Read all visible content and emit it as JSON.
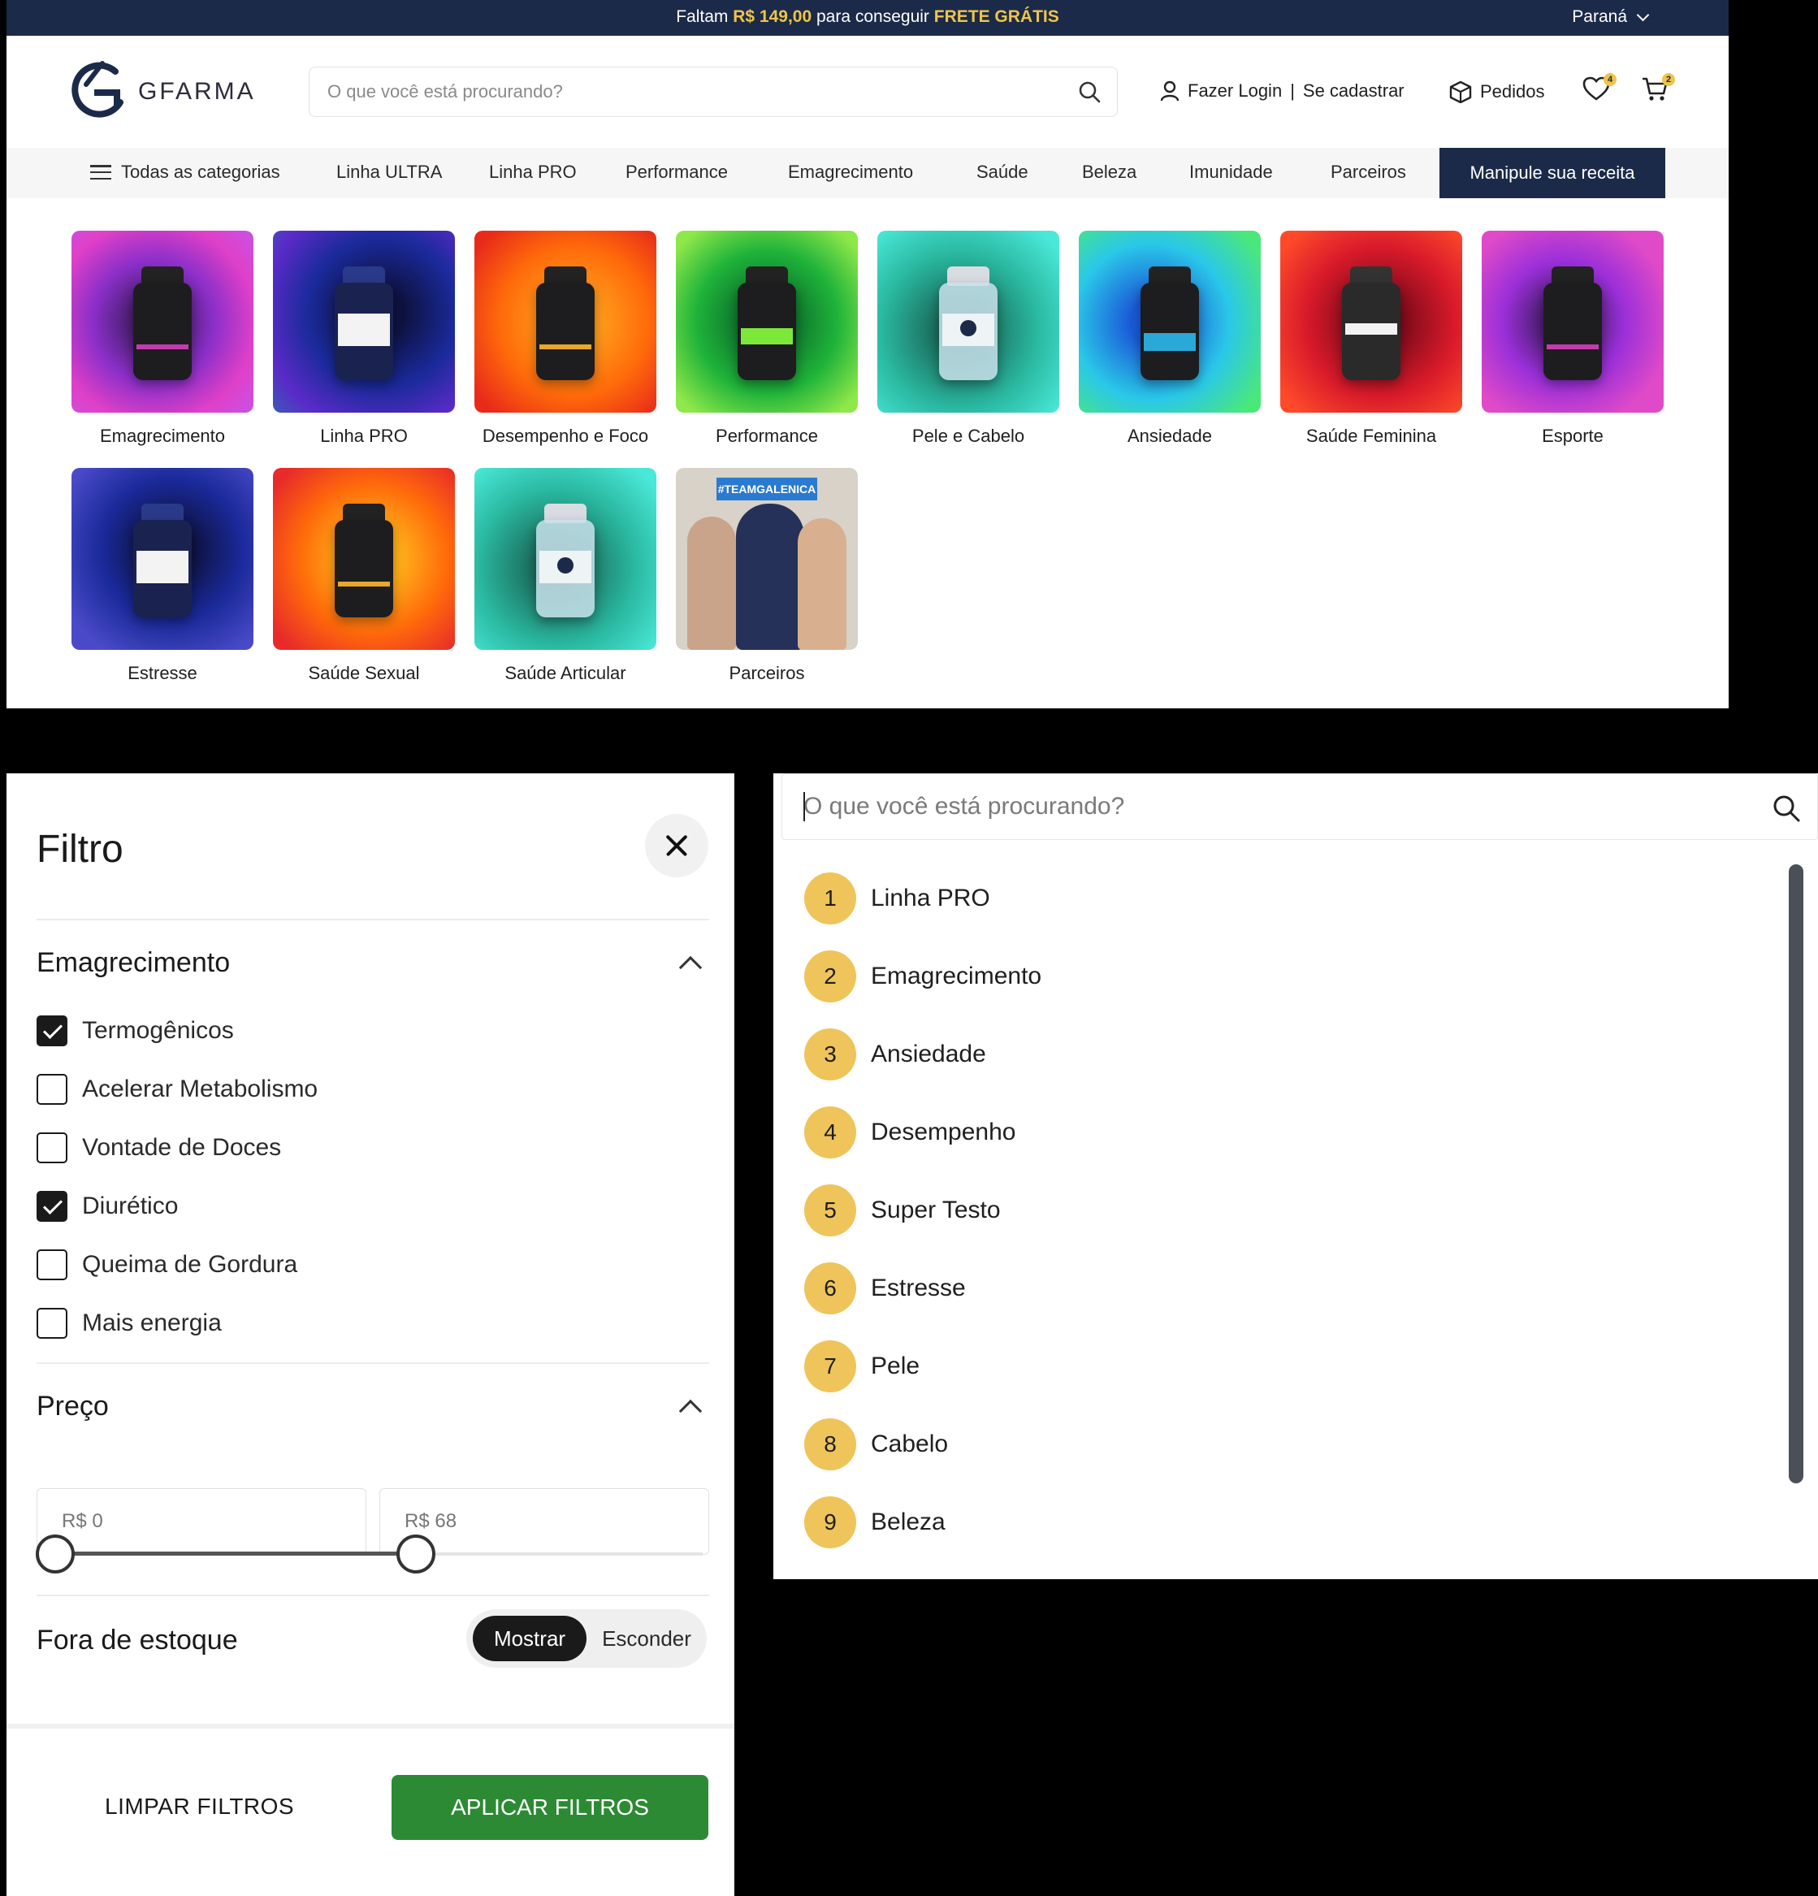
{
  "promo": {
    "pre": "Faltam",
    "amount": "R$ 149,00",
    "mid": "para conseguir",
    "highlight": "FRETE GRÁTIS",
    "region": "Paraná"
  },
  "header": {
    "logo_text": "GFARMA",
    "search_placeholder": "O que você está procurando?",
    "login": "Fazer Login",
    "separator": "|",
    "register": "Se cadastrar",
    "orders": "Pedidos",
    "wishlist_count": "4",
    "cart_count": "2"
  },
  "nav": {
    "all_categories": "Todas as categorias",
    "items": [
      "Linha ULTRA",
      "Linha PRO",
      "Performance",
      "Emagrecimento",
      "Saúde",
      "Beleza",
      "Imunidade",
      "Parceiros"
    ],
    "cta": "Manipule sua receita"
  },
  "categories": [
    {
      "label": "Emagrecimento"
    },
    {
      "label": "Linha PRO"
    },
    {
      "label": "Desempenho e Foco"
    },
    {
      "label": "Performance"
    },
    {
      "label": "Pele e Cabelo"
    },
    {
      "label": "Ansiedade"
    },
    {
      "label": "Saúde Feminina"
    },
    {
      "label": "Esporte"
    },
    {
      "label": "Estresse"
    },
    {
      "label": "Saúde Sexual"
    },
    {
      "label": "Saúde Articular"
    },
    {
      "label": "Parceiros",
      "tag": "#TEAMGALENICA"
    }
  ],
  "filter": {
    "title": "Filtro",
    "group_title": "Emagrecimento",
    "options": [
      {
        "label": "Termogênicos",
        "checked": true
      },
      {
        "label": "Acelerar Metabolismo",
        "checked": false
      },
      {
        "label": "Vontade de Doces",
        "checked": false
      },
      {
        "label": "Diurético",
        "checked": true
      },
      {
        "label": "Queima de Gordura",
        "checked": false
      },
      {
        "label": "Mais energia",
        "checked": false
      }
    ],
    "price_title": "Preço",
    "price_min": "R$ 0",
    "price_max": "R$ 68",
    "stock_title": "Fora de estoque",
    "stock_show": "Mostrar",
    "stock_hide": "Esconder",
    "clear": "LIMPAR FILTROS",
    "apply": "APLICAR FILTROS"
  },
  "suggest": {
    "placeholder": "O que você está procurando?",
    "items": [
      {
        "n": "1",
        "label": "Linha PRO"
      },
      {
        "n": "2",
        "label": "Emagrecimento"
      },
      {
        "n": "3",
        "label": "Ansiedade"
      },
      {
        "n": "4",
        "label": "Desempenho"
      },
      {
        "n": "5",
        "label": "Super Testo"
      },
      {
        "n": "6",
        "label": "Estresse"
      },
      {
        "n": "7",
        "label": "Pele"
      },
      {
        "n": "8",
        "label": "Cabelo"
      },
      {
        "n": "9",
        "label": "Beleza"
      }
    ]
  },
  "colors": {
    "navy": "#1b2a48",
    "gold": "#f0c44a",
    "green": "#2d8a34"
  }
}
